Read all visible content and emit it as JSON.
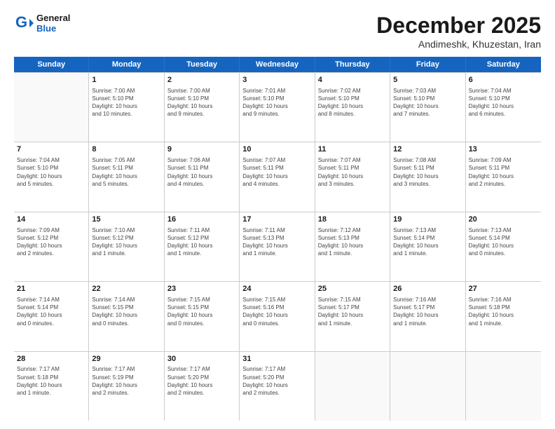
{
  "header": {
    "logo_line1": "General",
    "logo_line2": "Blue",
    "month": "December 2025",
    "location": "Andimeshk, Khuzestan, Iran"
  },
  "weekdays": [
    "Sunday",
    "Monday",
    "Tuesday",
    "Wednesday",
    "Thursday",
    "Friday",
    "Saturday"
  ],
  "rows": [
    [
      {
        "day": "",
        "info": ""
      },
      {
        "day": "1",
        "info": "Sunrise: 7:00 AM\nSunset: 5:10 PM\nDaylight: 10 hours\nand 10 minutes."
      },
      {
        "day": "2",
        "info": "Sunrise: 7:00 AM\nSunset: 5:10 PM\nDaylight: 10 hours\nand 9 minutes."
      },
      {
        "day": "3",
        "info": "Sunrise: 7:01 AM\nSunset: 5:10 PM\nDaylight: 10 hours\nand 9 minutes."
      },
      {
        "day": "4",
        "info": "Sunrise: 7:02 AM\nSunset: 5:10 PM\nDaylight: 10 hours\nand 8 minutes."
      },
      {
        "day": "5",
        "info": "Sunrise: 7:03 AM\nSunset: 5:10 PM\nDaylight: 10 hours\nand 7 minutes."
      },
      {
        "day": "6",
        "info": "Sunrise: 7:04 AM\nSunset: 5:10 PM\nDaylight: 10 hours\nand 6 minutes."
      }
    ],
    [
      {
        "day": "7",
        "info": "Sunrise: 7:04 AM\nSunset: 5:10 PM\nDaylight: 10 hours\nand 5 minutes."
      },
      {
        "day": "8",
        "info": "Sunrise: 7:05 AM\nSunset: 5:11 PM\nDaylight: 10 hours\nand 5 minutes."
      },
      {
        "day": "9",
        "info": "Sunrise: 7:06 AM\nSunset: 5:11 PM\nDaylight: 10 hours\nand 4 minutes."
      },
      {
        "day": "10",
        "info": "Sunrise: 7:07 AM\nSunset: 5:11 PM\nDaylight: 10 hours\nand 4 minutes."
      },
      {
        "day": "11",
        "info": "Sunrise: 7:07 AM\nSunset: 5:11 PM\nDaylight: 10 hours\nand 3 minutes."
      },
      {
        "day": "12",
        "info": "Sunrise: 7:08 AM\nSunset: 5:11 PM\nDaylight: 10 hours\nand 3 minutes."
      },
      {
        "day": "13",
        "info": "Sunrise: 7:09 AM\nSunset: 5:11 PM\nDaylight: 10 hours\nand 2 minutes."
      }
    ],
    [
      {
        "day": "14",
        "info": "Sunrise: 7:09 AM\nSunset: 5:12 PM\nDaylight: 10 hours\nand 2 minutes."
      },
      {
        "day": "15",
        "info": "Sunrise: 7:10 AM\nSunset: 5:12 PM\nDaylight: 10 hours\nand 1 minute."
      },
      {
        "day": "16",
        "info": "Sunrise: 7:11 AM\nSunset: 5:12 PM\nDaylight: 10 hours\nand 1 minute."
      },
      {
        "day": "17",
        "info": "Sunrise: 7:11 AM\nSunset: 5:13 PM\nDaylight: 10 hours\nand 1 minute."
      },
      {
        "day": "18",
        "info": "Sunrise: 7:12 AM\nSunset: 5:13 PM\nDaylight: 10 hours\nand 1 minute."
      },
      {
        "day": "19",
        "info": "Sunrise: 7:13 AM\nSunset: 5:14 PM\nDaylight: 10 hours\nand 1 minute."
      },
      {
        "day": "20",
        "info": "Sunrise: 7:13 AM\nSunset: 5:14 PM\nDaylight: 10 hours\nand 0 minutes."
      }
    ],
    [
      {
        "day": "21",
        "info": "Sunrise: 7:14 AM\nSunset: 5:14 PM\nDaylight: 10 hours\nand 0 minutes."
      },
      {
        "day": "22",
        "info": "Sunrise: 7:14 AM\nSunset: 5:15 PM\nDaylight: 10 hours\nand 0 minutes."
      },
      {
        "day": "23",
        "info": "Sunrise: 7:15 AM\nSunset: 5:15 PM\nDaylight: 10 hours\nand 0 minutes."
      },
      {
        "day": "24",
        "info": "Sunrise: 7:15 AM\nSunset: 5:16 PM\nDaylight: 10 hours\nand 0 minutes."
      },
      {
        "day": "25",
        "info": "Sunrise: 7:15 AM\nSunset: 5:17 PM\nDaylight: 10 hours\nand 1 minute."
      },
      {
        "day": "26",
        "info": "Sunrise: 7:16 AM\nSunset: 5:17 PM\nDaylight: 10 hours\nand 1 minute."
      },
      {
        "day": "27",
        "info": "Sunrise: 7:16 AM\nSunset: 5:18 PM\nDaylight: 10 hours\nand 1 minute."
      }
    ],
    [
      {
        "day": "28",
        "info": "Sunrise: 7:17 AM\nSunset: 5:18 PM\nDaylight: 10 hours\nand 1 minute."
      },
      {
        "day": "29",
        "info": "Sunrise: 7:17 AM\nSunset: 5:19 PM\nDaylight: 10 hours\nand 2 minutes."
      },
      {
        "day": "30",
        "info": "Sunrise: 7:17 AM\nSunset: 5:20 PM\nDaylight: 10 hours\nand 2 minutes."
      },
      {
        "day": "31",
        "info": "Sunrise: 7:17 AM\nSunset: 5:20 PM\nDaylight: 10 hours\nand 2 minutes."
      },
      {
        "day": "",
        "info": ""
      },
      {
        "day": "",
        "info": ""
      },
      {
        "day": "",
        "info": ""
      }
    ]
  ]
}
